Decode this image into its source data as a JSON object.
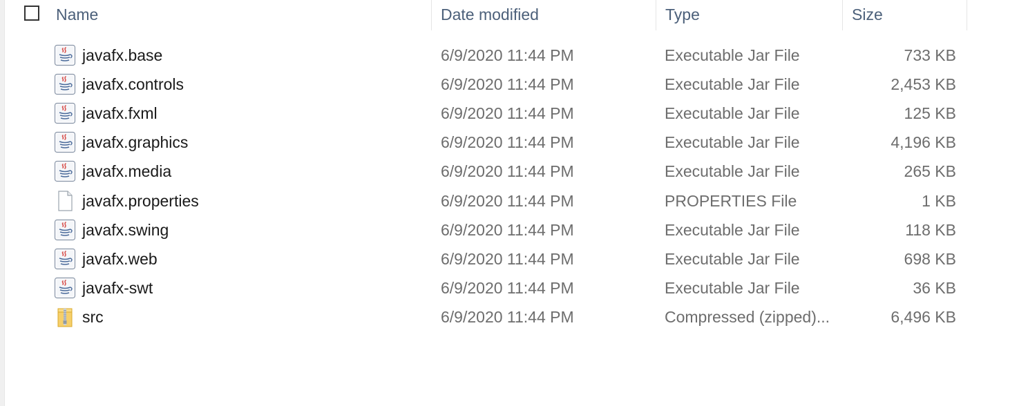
{
  "columns": {
    "name": "Name",
    "date": "Date modified",
    "type": "Type",
    "size": "Size"
  },
  "files": [
    {
      "name": "javafx.base",
      "date": "6/9/2020 11:44 PM",
      "type": "Executable Jar File",
      "size": "733 KB",
      "icon": "jar"
    },
    {
      "name": "javafx.controls",
      "date": "6/9/2020 11:44 PM",
      "type": "Executable Jar File",
      "size": "2,453 KB",
      "icon": "jar"
    },
    {
      "name": "javafx.fxml",
      "date": "6/9/2020 11:44 PM",
      "type": "Executable Jar File",
      "size": "125 KB",
      "icon": "jar"
    },
    {
      "name": "javafx.graphics",
      "date": "6/9/2020 11:44 PM",
      "type": "Executable Jar File",
      "size": "4,196 KB",
      "icon": "jar"
    },
    {
      "name": "javafx.media",
      "date": "6/9/2020 11:44 PM",
      "type": "Executable Jar File",
      "size": "265 KB",
      "icon": "jar"
    },
    {
      "name": "javafx.properties",
      "date": "6/9/2020 11:44 PM",
      "type": "PROPERTIES File",
      "size": "1 KB",
      "icon": "file"
    },
    {
      "name": "javafx.swing",
      "date": "6/9/2020 11:44 PM",
      "type": "Executable Jar File",
      "size": "118 KB",
      "icon": "jar"
    },
    {
      "name": "javafx.web",
      "date": "6/9/2020 11:44 PM",
      "type": "Executable Jar File",
      "size": "698 KB",
      "icon": "jar"
    },
    {
      "name": "javafx-swt",
      "date": "6/9/2020 11:44 PM",
      "type": "Executable Jar File",
      "size": "36 KB",
      "icon": "jar"
    },
    {
      "name": "src",
      "date": "6/9/2020 11:44 PM",
      "type": "Compressed (zipped)...",
      "size": "6,496 KB",
      "icon": "zip"
    }
  ]
}
